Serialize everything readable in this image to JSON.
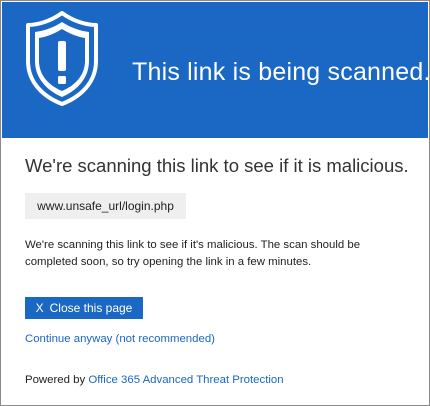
{
  "banner": {
    "title": "This link is being scanned.",
    "icon": "shield-exclamation-icon",
    "background_color": "#1b67c4"
  },
  "main": {
    "heading": "We're scanning this link to see if it is malicious.",
    "url": "www.unsafe_url/login.php",
    "description": "We're scanning this link to see if it's malicious. The scan should be completed soon, so try opening the link in a few minutes."
  },
  "actions": {
    "close_icon": "X",
    "close_label": "Close this page",
    "continue_label": "Continue anyway (not recommended)"
  },
  "footer": {
    "powered_prefix": "Powered by",
    "powered_link": "Office 365 Advanced Threat Protection"
  }
}
